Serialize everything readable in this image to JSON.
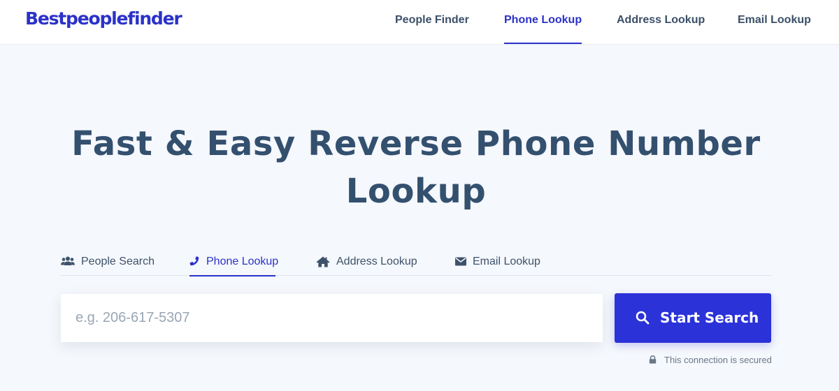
{
  "brand": {
    "logo_text": "Bestpeoplefinder",
    "accent_color": "#2b32c9"
  },
  "nav": {
    "items": [
      {
        "label": "People Finder",
        "active": false
      },
      {
        "label": "Phone Lookup",
        "active": true
      },
      {
        "label": "Address Lookup",
        "active": false
      },
      {
        "label": "Email Lookup",
        "active": false
      }
    ]
  },
  "hero": {
    "title_line1": "Fast & Easy Reverse Phone Number",
    "title_line2": "Lookup"
  },
  "search_tabs": [
    {
      "label": "People Search",
      "icon": "people-icon",
      "active": false
    },
    {
      "label": "Phone Lookup",
      "icon": "phone-icon",
      "active": true
    },
    {
      "label": "Address Lookup",
      "icon": "home-icon",
      "active": false
    },
    {
      "label": "Email Lookup",
      "icon": "envelope-icon",
      "active": false
    }
  ],
  "search": {
    "placeholder": "e.g. 206-617-5307",
    "value": "",
    "button_label": "Start Search",
    "button_color": "#2b32d8"
  },
  "security_note": {
    "text": "This connection is secured",
    "icon": "lock-icon"
  }
}
